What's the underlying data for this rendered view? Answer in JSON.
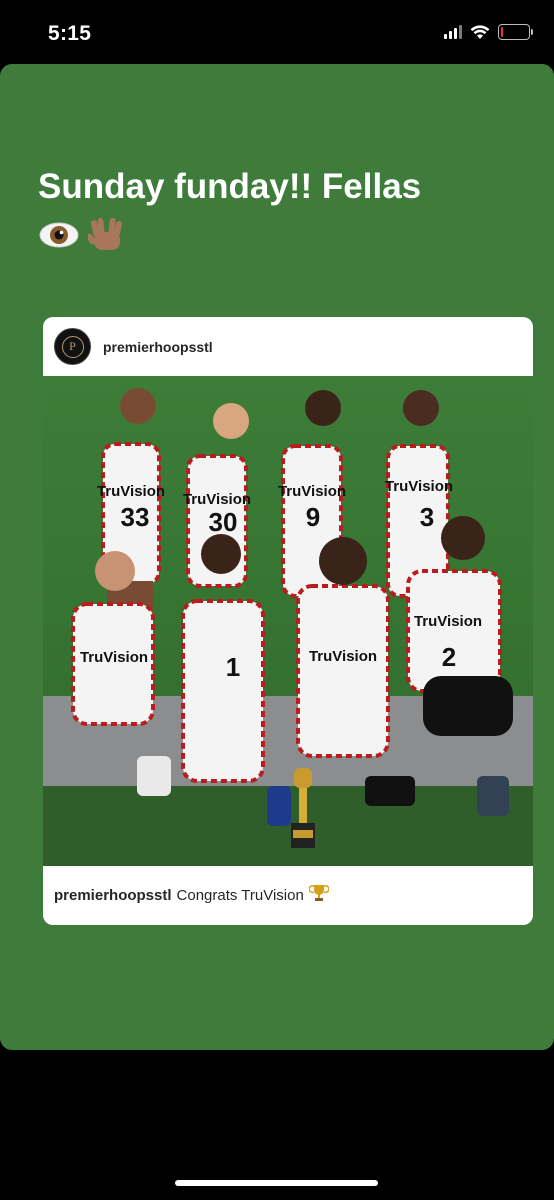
{
  "status_bar": {
    "time": "5:15",
    "battery_level": 0.05
  },
  "story": {
    "background_color": "#3f7c3b",
    "text": "Sunday funday!! Fellas",
    "emojis": [
      "eye-icon",
      "vulcan-salute-icon"
    ]
  },
  "post": {
    "username": "premierhoopsstl",
    "caption_username": "premierhoopsstl",
    "caption_text": "Congrats TruVision",
    "caption_icon": "trophy-icon",
    "photo": {
      "description_icon": "team-photo",
      "jersey_brand": "TruVision",
      "jersey_numbers": [
        "33",
        "30",
        "9",
        "3",
        "",
        "1",
        "",
        "2"
      ]
    }
  }
}
